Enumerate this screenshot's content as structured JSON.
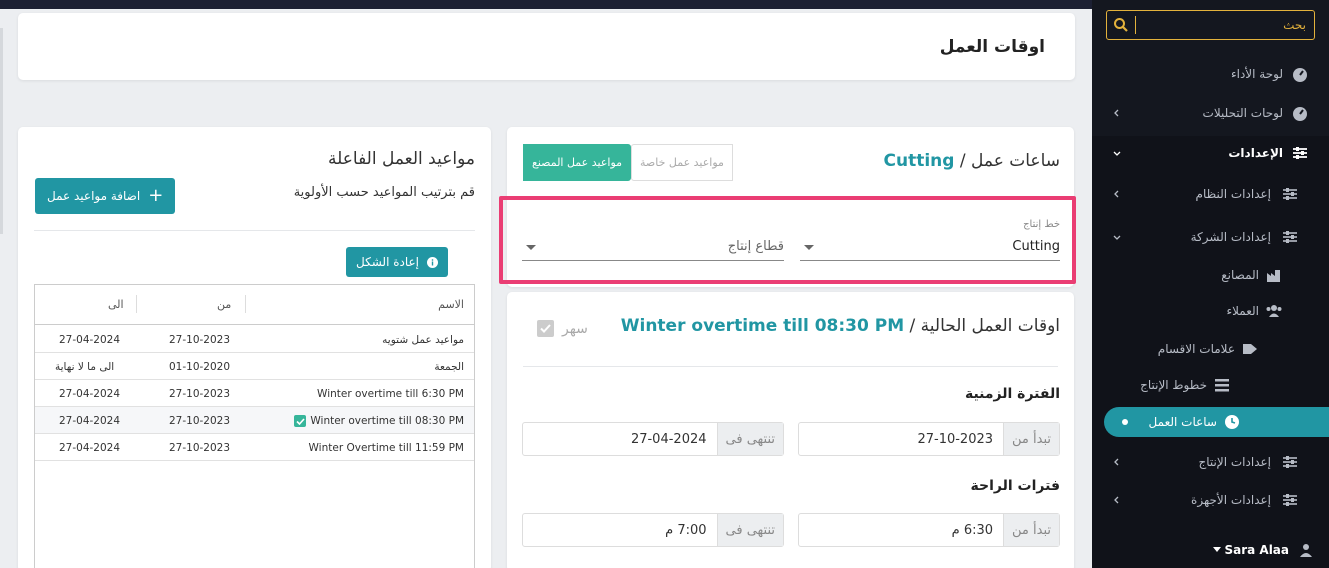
{
  "sidebar": {
    "search_placeholder": "بحث",
    "items": [
      {
        "label": "لوحة الأداء",
        "icon": "gauge-icon"
      },
      {
        "label": "لوحات التحليلات",
        "icon": "gauge-icon"
      },
      {
        "label": "الإعدادات",
        "icon": "sliders-icon"
      },
      {
        "label": "إعدادات النظام",
        "icon": "sliders-icon"
      },
      {
        "label": "إعدادات الشركة",
        "icon": "sliders-icon"
      },
      {
        "label": "المصانع",
        "icon": "factory-icon"
      },
      {
        "label": "العملاء",
        "icon": "users-icon"
      },
      {
        "label": "علامات الاقسام",
        "icon": "tag-icon"
      },
      {
        "label": "خطوط الإنتاج",
        "icon": "lines-icon"
      },
      {
        "label": "ساعات العمل",
        "icon": "clock-icon"
      },
      {
        "label": "إعدادات الإنتاج",
        "icon": "sliders-icon"
      },
      {
        "label": "إعدادات الأجهزة",
        "icon": "sliders-icon"
      }
    ],
    "user": "Sara Alaa"
  },
  "header": {
    "title": "اوقات العمل"
  },
  "work_hours": {
    "title_prefix": "ساعات عمل /",
    "line_name": "Cutting",
    "toggle_factory": "مواعيد عمل المصنع",
    "toggle_special": "مواعيد عمل خاصة",
    "line_label": "خط إنتاج",
    "line_value": "Cutting",
    "sector_placeholder": "قطاع إنتاج"
  },
  "current": {
    "title_prefix": "اوقات العمل الحالية /",
    "schedule_name": "Winter overtime till 08:30 PM",
    "overnight_label": "سهر",
    "period_title": "الفترة الزمنية",
    "start_label": "تبدأ من",
    "start_value": "27-10-2023",
    "end_label": "تنتهى فى",
    "end_value": "27-04-2024",
    "breaks_title": "فترات الراحة",
    "break_start_label": "تبدأ من",
    "break_start_value": "6:30 م",
    "break_end_label": "تنتهى فى",
    "break_end_value": "7:00 م"
  },
  "active_schedules": {
    "title": "مواعيد العمل الفاعلة",
    "subtitle": "قم بترتيب المواعيد حسب الأولوية",
    "add_button": "اضافة مواعيد عمل",
    "reset_button": "إعادة الشكل",
    "columns": [
      "الاسم",
      "من",
      "الى"
    ],
    "rows": [
      {
        "name": "مواعيد عمل شتويه",
        "from": "27-10-2023",
        "to": "27-04-2024",
        "checked": false
      },
      {
        "name": "الجمعة",
        "from": "01-10-2020",
        "to": "الى ما لا نهاية",
        "checked": false
      },
      {
        "name": "Winter overtime till 6:30 PM",
        "from": "27-10-2023",
        "to": "27-04-2024",
        "checked": false
      },
      {
        "name": "Winter overtime till 08:30 PM",
        "from": "27-10-2023",
        "to": "27-04-2024",
        "checked": true
      },
      {
        "name": "Winter Overtime till 11:59 PM",
        "from": "27-10-2023",
        "to": "27-04-2024",
        "checked": false
      }
    ]
  },
  "colors": {
    "accent": "#2196a3",
    "green": "#36b59a",
    "highlight": "#ea3d73",
    "sidebar": "#14171f"
  }
}
